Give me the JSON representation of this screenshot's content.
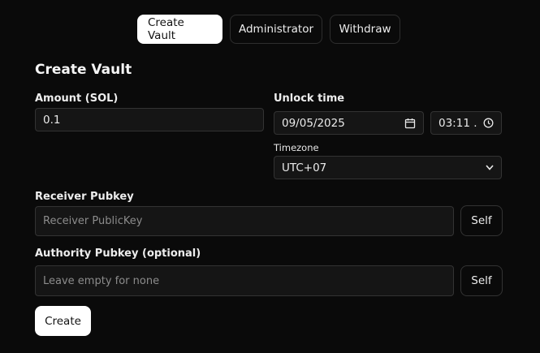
{
  "tabs": [
    {
      "label": "Create Vault",
      "active": true
    },
    {
      "label": "Administrator",
      "active": false
    },
    {
      "label": "Withdraw",
      "active": false
    }
  ],
  "form": {
    "title": "Create Vault",
    "amount": {
      "label": "Amount (SOL)",
      "value": "0.1"
    },
    "unlock": {
      "label": "Unlock time",
      "date": "09/05/2025",
      "time": "03:11 .",
      "timezone_label": "Timezone",
      "timezone": "UTC+07"
    },
    "receiver": {
      "label": "Receiver Pubkey",
      "placeholder": "Receiver PublicKey",
      "self_label": "Self"
    },
    "authority": {
      "label": "Authority Pubkey (optional)",
      "placeholder": "Leave empty for none",
      "self_label": "Self"
    },
    "submit_label": "Create"
  },
  "colors": {
    "background": "#0a0a0a",
    "field": "#151515",
    "border": "#333333",
    "accent": "#ffffff"
  }
}
